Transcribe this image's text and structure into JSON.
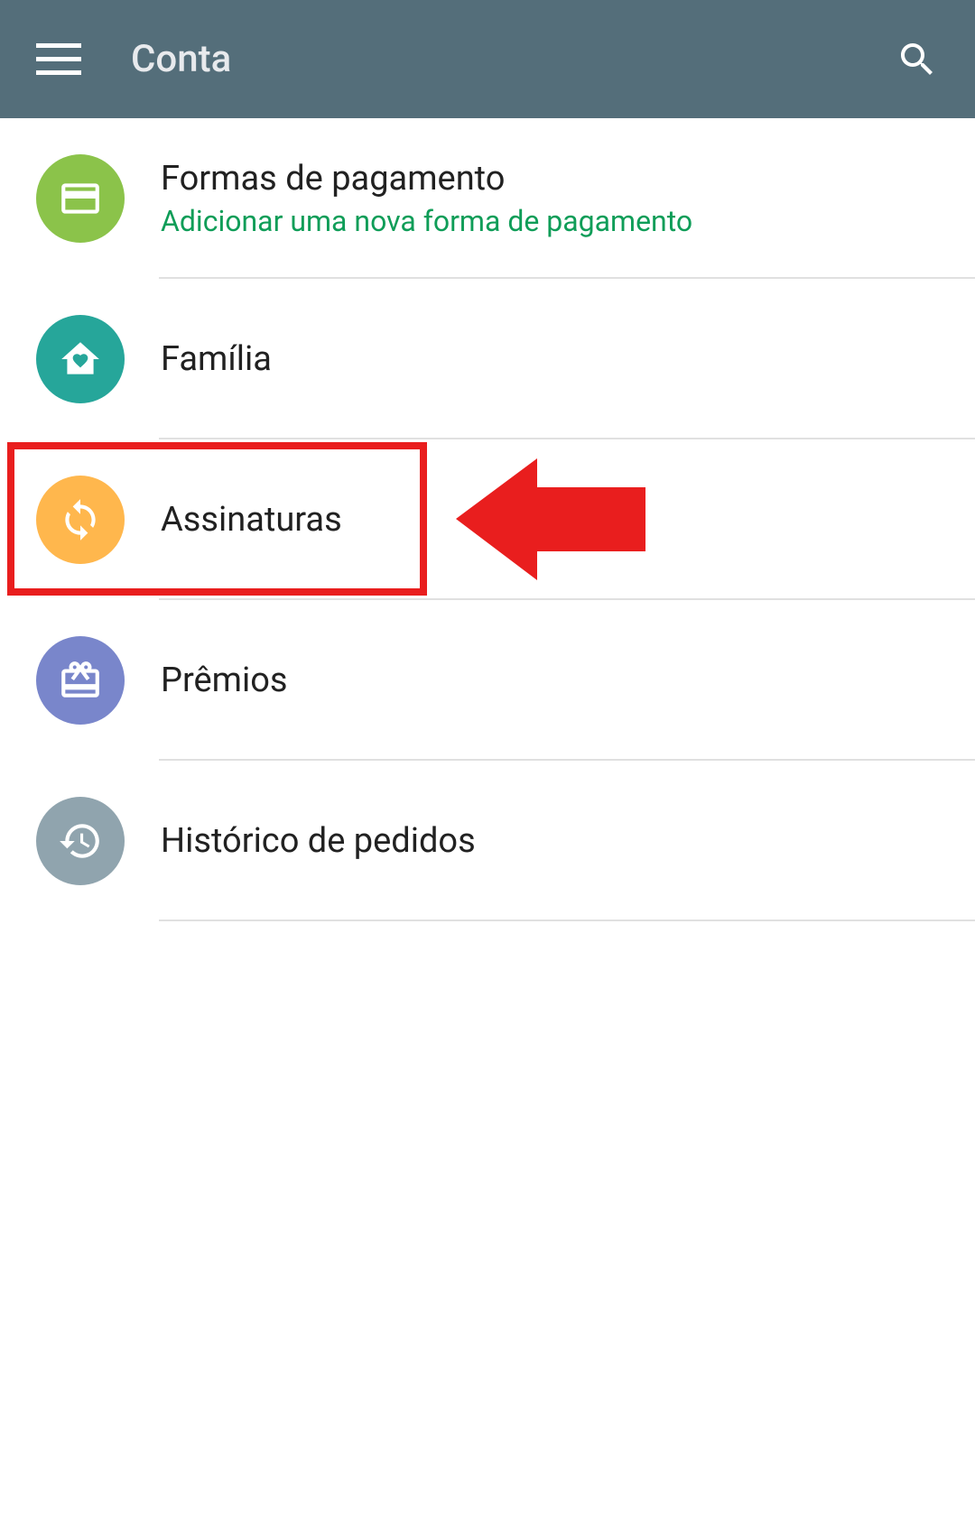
{
  "header": {
    "title": "Conta"
  },
  "items": [
    {
      "title": "Formas de pagamento",
      "subtitle": "Adicionar uma nova forma de pagamento",
      "iconColor": "bg-green",
      "icon": "card"
    },
    {
      "title": "Família",
      "subtitle": "",
      "iconColor": "bg-teal",
      "icon": "home"
    },
    {
      "title": "Assinaturas",
      "subtitle": "",
      "iconColor": "bg-orange",
      "icon": "refresh"
    },
    {
      "title": "Prêmios",
      "subtitle": "",
      "iconColor": "bg-purple",
      "icon": "gift"
    },
    {
      "title": "Histórico de pedidos",
      "subtitle": "",
      "iconColor": "bg-gray",
      "icon": "history"
    }
  ]
}
